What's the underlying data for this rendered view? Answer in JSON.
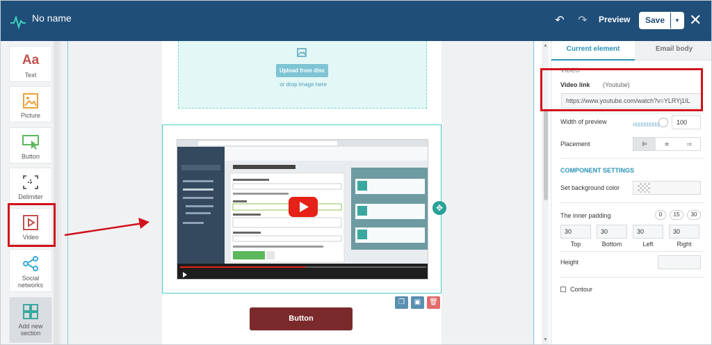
{
  "app": {
    "title": "No name"
  },
  "toolbar": {
    "undo_icon": "undo-icon",
    "redo_icon": "redo-icon",
    "preview_label": "Preview",
    "save_label": "Save",
    "close_label": "✕"
  },
  "left_tools": [
    {
      "id": "text",
      "label": "Text",
      "icon": "text-icon",
      "color": "#c0504d"
    },
    {
      "id": "picture",
      "label": "Picture",
      "icon": "picture-icon",
      "color": "#e8a33a"
    },
    {
      "id": "button",
      "label": "Button",
      "icon": "button-icon",
      "color": "#5cb85c"
    },
    {
      "id": "delimiter",
      "label": "Delimiter",
      "icon": "delimiter-icon",
      "color": "#666666"
    },
    {
      "id": "video",
      "label": "Video",
      "icon": "video-icon",
      "color": "#c0504d"
    },
    {
      "id": "social",
      "label_line1": "Social",
      "label_line2": "networks",
      "icon": "share-icon",
      "color": "#3aa8d8"
    },
    {
      "id": "add",
      "label_line1": "Add new",
      "label_line2": "section",
      "icon": "grid-icon",
      "color": "#3aa8a0"
    }
  ],
  "canvas": {
    "upload_button": "Upload from disc",
    "drop_text": "or drop image here",
    "email_button": "Button",
    "video_preview": {
      "brand": "SendPulse",
      "heading": "Send a push notification",
      "menu": [
        "Dashboard",
        "My campaigns",
        "My websites",
        "login.sendpulse.com",
        "sendpulse.com",
        "Plans"
      ],
      "fields": [
        "List of recipients",
        "Title",
        "Web push text",
        "Web push link"
      ],
      "send_label": "Send"
    }
  },
  "right_panel": {
    "tabs": [
      "Current element",
      "Email body"
    ],
    "section_video": "VIDEO",
    "video_link_label": "Video link",
    "video_link_hint": "(Youtube)",
    "video_link_value": "https://www.youtube.com/watch?v=YLRYj1IL",
    "width_label": "Width of preview",
    "width_value": "100",
    "width_fraction": 0.95,
    "placement_label": "Placement",
    "placement_selected": "left",
    "component_settings": "COMPONENT SETTINGS",
    "bg_color_label": "Set background color",
    "inner_padding_label": "The inner padding",
    "padding_presets": [
      "0",
      "15",
      "30"
    ],
    "padding": {
      "top": "30",
      "bottom": "30",
      "left": "30",
      "right": "30"
    },
    "padding_captions": {
      "top": "Top",
      "bottom": "Bottom",
      "left": "Left",
      "right": "Right"
    },
    "height_label": "Height",
    "contour_label": "Contour"
  },
  "colors": {
    "topbar": "#1f4e79",
    "accent": "#2a93b8",
    "video_border": "#45cec2",
    "email_button": "#7b2a2b",
    "annotation": "#d0111b"
  }
}
